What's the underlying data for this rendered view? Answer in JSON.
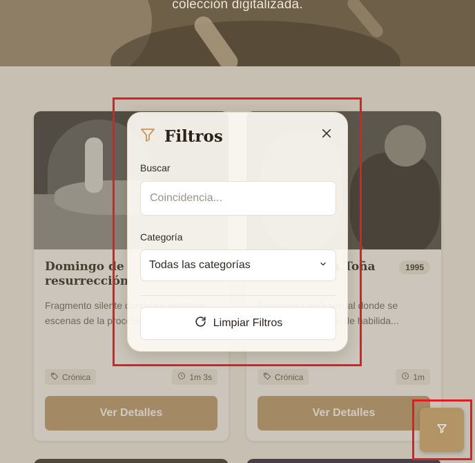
{
  "hero": {
    "subtitle": "colección digitalizada."
  },
  "cards": [
    {
      "title": "Domingo de resurrección",
      "year": "",
      "description": "Fragmento silente donde se registran escenas de la procesión",
      "category": "Crónica",
      "duration": "1m 3s",
      "button_label": "Ver Detalles"
    },
    {
      "title": "Feria del Ma Toña",
      "year": "1995",
      "description": "Fragmento audiovisual donde se exponen concursos de habilida...",
      "category": "Crónica",
      "duration": "1m",
      "button_label": "Ver Detalles"
    }
  ],
  "filters": {
    "title": "Filtros",
    "search_label": "Buscar",
    "search_placeholder": "Coincidencia...",
    "category_label": "Categoría",
    "category_selected": "Todas las categorías",
    "clear_label": "Limpiar Filtros"
  },
  "icons": {
    "filter": "filter-icon",
    "close": "close-icon",
    "refresh": "refresh-icon",
    "tag": "tag-icon",
    "clock": "clock-icon",
    "chevron": "chevron-down-icon"
  },
  "colors": {
    "accent": "#bd9a6c",
    "highlight": "#e11d24"
  }
}
